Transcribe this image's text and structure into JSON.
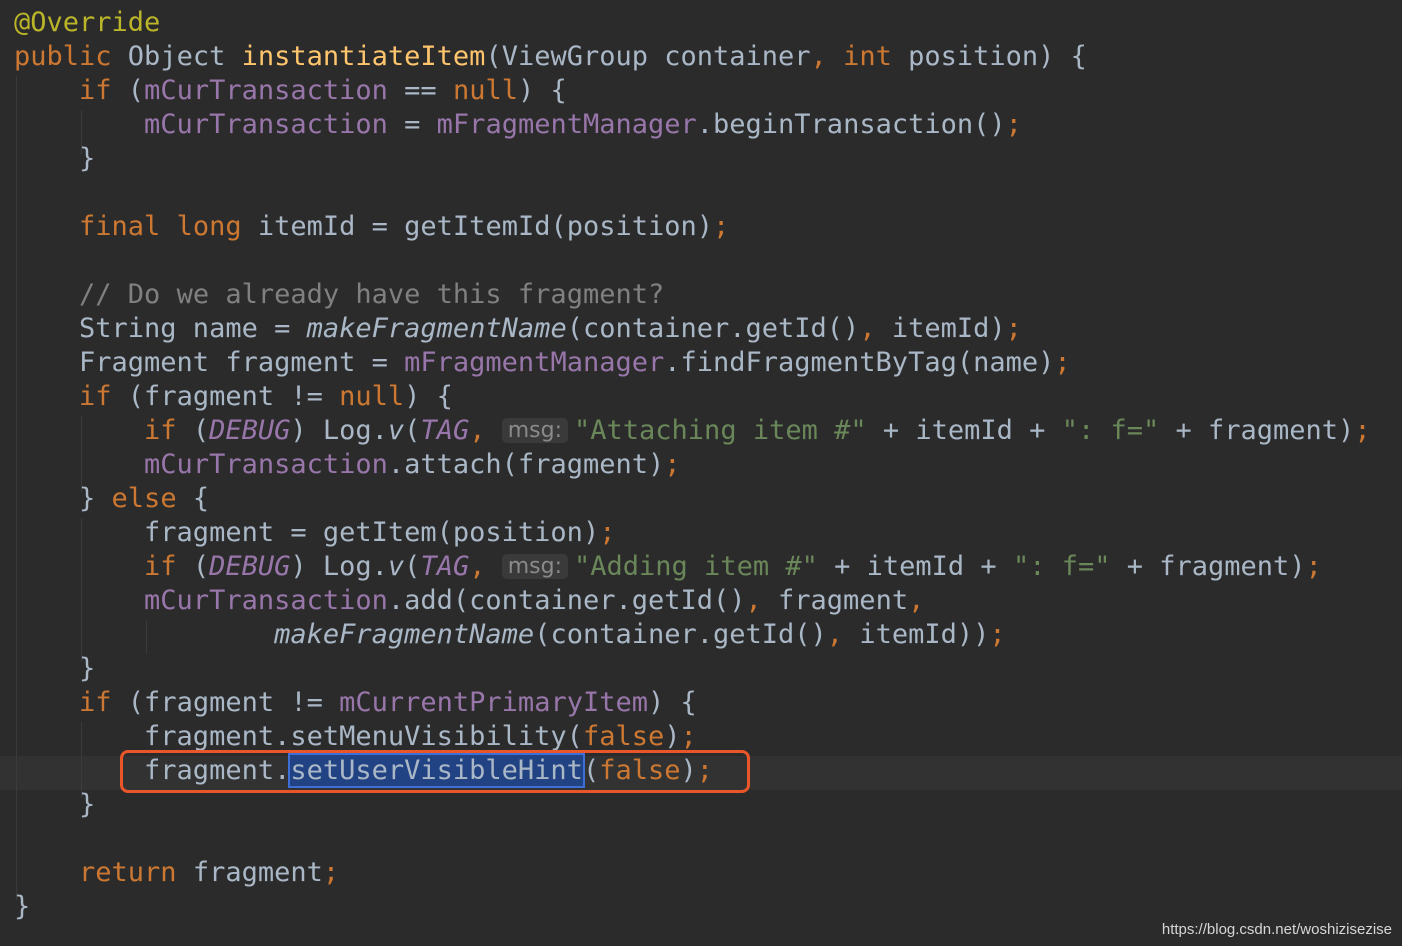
{
  "lines": [
    {
      "tokens": [
        {
          "t": "@Override",
          "c": "ann"
        }
      ]
    },
    {
      "tokens": [
        {
          "t": "public",
          "c": "kw"
        },
        {
          "t": " Object ",
          "c": "plain"
        },
        {
          "t": "instantiateItem",
          "c": "fn"
        },
        {
          "t": "(ViewGroup container",
          "c": "plain"
        },
        {
          "t": ", ",
          "c": "kw"
        },
        {
          "t": "int",
          "c": "kw"
        },
        {
          "t": " position) {",
          "c": "plain"
        }
      ]
    },
    {
      "tokens": [
        {
          "t": "    ",
          "c": "plain"
        },
        {
          "t": "if",
          "c": "kw"
        },
        {
          "t": " (",
          "c": "plain"
        },
        {
          "t": "mCurTransaction",
          "c": "fld"
        },
        {
          "t": " == ",
          "c": "plain"
        },
        {
          "t": "null",
          "c": "kw"
        },
        {
          "t": ") {",
          "c": "plain"
        }
      ]
    },
    {
      "tokens": [
        {
          "t": "        ",
          "c": "plain"
        },
        {
          "t": "mCurTransaction",
          "c": "fld"
        },
        {
          "t": " = ",
          "c": "plain"
        },
        {
          "t": "mFragmentManager",
          "c": "fld"
        },
        {
          "t": ".beginTransaction()",
          "c": "plain"
        },
        {
          "t": ";",
          "c": "kw"
        }
      ]
    },
    {
      "tokens": [
        {
          "t": "    }",
          "c": "plain"
        }
      ]
    },
    {
      "tokens": []
    },
    {
      "tokens": [
        {
          "t": "    ",
          "c": "plain"
        },
        {
          "t": "final",
          "c": "kw"
        },
        {
          "t": " ",
          "c": "plain"
        },
        {
          "t": "long",
          "c": "kw"
        },
        {
          "t": " itemId = getItemId(position)",
          "c": "plain"
        },
        {
          "t": ";",
          "c": "kw"
        }
      ]
    },
    {
      "tokens": []
    },
    {
      "tokens": [
        {
          "t": "    ",
          "c": "plain"
        },
        {
          "t": "// Do we already have this fragment?",
          "c": "com"
        }
      ]
    },
    {
      "tokens": [
        {
          "t": "    String name = ",
          "c": "plain"
        },
        {
          "t": "makeFragmentName",
          "c": "ital"
        },
        {
          "t": "(container.getId()",
          "c": "plain"
        },
        {
          "t": ", ",
          "c": "kw"
        },
        {
          "t": "itemId)",
          "c": "plain"
        },
        {
          "t": ";",
          "c": "kw"
        }
      ]
    },
    {
      "tokens": [
        {
          "t": "    Fragment fragment = ",
          "c": "plain"
        },
        {
          "t": "mFragmentManager",
          "c": "fld"
        },
        {
          "t": ".findFragmentByTag(name)",
          "c": "plain"
        },
        {
          "t": ";",
          "c": "kw"
        }
      ]
    },
    {
      "tokens": [
        {
          "t": "    ",
          "c": "plain"
        },
        {
          "t": "if",
          "c": "kw"
        },
        {
          "t": " (fragment != ",
          "c": "plain"
        },
        {
          "t": "null",
          "c": "kw"
        },
        {
          "t": ") {",
          "c": "plain"
        }
      ]
    },
    {
      "tokens": [
        {
          "t": "        ",
          "c": "plain"
        },
        {
          "t": "if",
          "c": "kw"
        },
        {
          "t": " (",
          "c": "plain"
        },
        {
          "t": "DEBUG",
          "c": "sfld"
        },
        {
          "t": ") Log.",
          "c": "plain"
        },
        {
          "t": "v",
          "c": "ital"
        },
        {
          "t": "(",
          "c": "plain"
        },
        {
          "t": "TAG",
          "c": "sfld"
        },
        {
          "t": ", ",
          "c": "kw"
        },
        {
          "t": "msg:",
          "c": "hint"
        },
        {
          "t": "\"Attaching item #\"",
          "c": "str"
        },
        {
          "t": " + itemId + ",
          "c": "plain"
        },
        {
          "t": "\": f=\"",
          "c": "str"
        },
        {
          "t": " + fragment)",
          "c": "plain"
        },
        {
          "t": ";",
          "c": "kw"
        }
      ]
    },
    {
      "tokens": [
        {
          "t": "        ",
          "c": "plain"
        },
        {
          "t": "mCurTransaction",
          "c": "fld"
        },
        {
          "t": ".attach(fragment)",
          "c": "plain"
        },
        {
          "t": ";",
          "c": "kw"
        }
      ]
    },
    {
      "tokens": [
        {
          "t": "    } ",
          "c": "plain"
        },
        {
          "t": "else",
          "c": "kw"
        },
        {
          "t": " {",
          "c": "plain"
        }
      ]
    },
    {
      "tokens": [
        {
          "t": "        fragment = getItem(position)",
          "c": "plain"
        },
        {
          "t": ";",
          "c": "kw"
        }
      ]
    },
    {
      "tokens": [
        {
          "t": "        ",
          "c": "plain"
        },
        {
          "t": "if",
          "c": "kw"
        },
        {
          "t": " (",
          "c": "plain"
        },
        {
          "t": "DEBUG",
          "c": "sfld"
        },
        {
          "t": ") Log.",
          "c": "plain"
        },
        {
          "t": "v",
          "c": "ital"
        },
        {
          "t": "(",
          "c": "plain"
        },
        {
          "t": "TAG",
          "c": "sfld"
        },
        {
          "t": ", ",
          "c": "kw"
        },
        {
          "t": "msg:",
          "c": "hint"
        },
        {
          "t": "\"Adding item #\"",
          "c": "str"
        },
        {
          "t": " + itemId + ",
          "c": "plain"
        },
        {
          "t": "\": f=\"",
          "c": "str"
        },
        {
          "t": " + fragment)",
          "c": "plain"
        },
        {
          "t": ";",
          "c": "kw"
        }
      ]
    },
    {
      "tokens": [
        {
          "t": "        ",
          "c": "plain"
        },
        {
          "t": "mCurTransaction",
          "c": "fld"
        },
        {
          "t": ".add(container.getId()",
          "c": "plain"
        },
        {
          "t": ", ",
          "c": "kw"
        },
        {
          "t": "fragment",
          "c": "plain"
        },
        {
          "t": ",",
          "c": "kw"
        }
      ]
    },
    {
      "tokens": [
        {
          "t": "                ",
          "c": "plain"
        },
        {
          "t": "makeFragmentName",
          "c": "ital"
        },
        {
          "t": "(container.getId()",
          "c": "plain"
        },
        {
          "t": ", ",
          "c": "kw"
        },
        {
          "t": "itemId))",
          "c": "plain"
        },
        {
          "t": ";",
          "c": "kw"
        }
      ]
    },
    {
      "tokens": [
        {
          "t": "    }",
          "c": "plain"
        }
      ]
    },
    {
      "tokens": [
        {
          "t": "    ",
          "c": "plain"
        },
        {
          "t": "if",
          "c": "kw"
        },
        {
          "t": " (fragment != ",
          "c": "plain"
        },
        {
          "t": "mCurrentPrimaryItem",
          "c": "fld"
        },
        {
          "t": ") {",
          "c": "plain"
        }
      ]
    },
    {
      "tokens": [
        {
          "t": "        fragment.setMenuVisibility(",
          "c": "plain"
        },
        {
          "t": "false",
          "c": "kw"
        },
        {
          "t": ")",
          "c": "plain"
        },
        {
          "t": ";",
          "c": "kw"
        }
      ]
    },
    {
      "tokens": [
        {
          "t": "        fragment.",
          "c": "plain"
        },
        {
          "t": "setUserVisibleHint",
          "c": "sel"
        },
        {
          "t": "(",
          "c": "plain"
        },
        {
          "t": "false",
          "c": "kw"
        },
        {
          "t": ")",
          "c": "plain"
        },
        {
          "t": ";",
          "c": "kw"
        }
      ]
    },
    {
      "tokens": [
        {
          "t": "    }",
          "c": "plain"
        }
      ]
    },
    {
      "tokens": []
    },
    {
      "tokens": [
        {
          "t": "    ",
          "c": "plain"
        },
        {
          "t": "return",
          "c": "kw"
        },
        {
          "t": " fragment",
          "c": "plain"
        },
        {
          "t": ";",
          "c": "kw"
        }
      ]
    },
    {
      "tokens": [
        {
          "t": "}",
          "c": "plain"
        }
      ]
    }
  ],
  "watermark": "https://blog.csdn.net/woshizisezise"
}
